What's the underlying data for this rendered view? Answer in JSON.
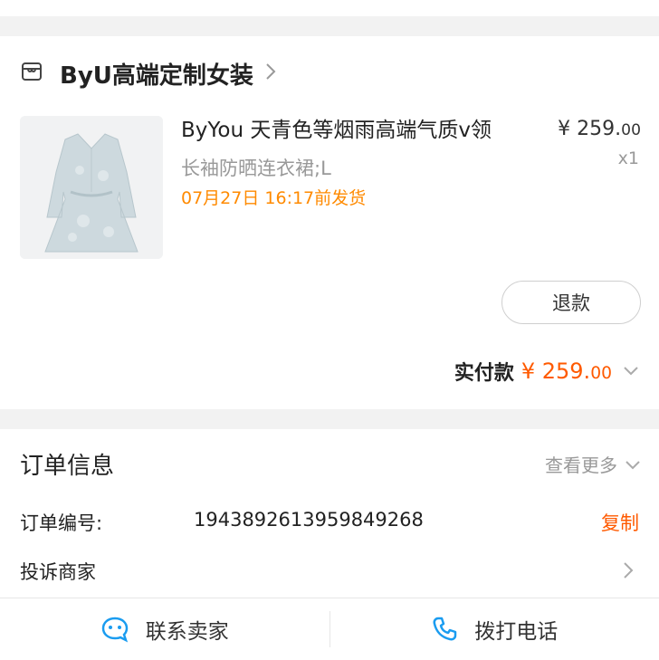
{
  "shop": {
    "name": "ByU高端定制女装",
    "icon": "store-icon"
  },
  "product": {
    "title": "ByYou 天青色等烟雨高端气质v领",
    "sku": "长袖防晒连衣裙;L",
    "ship_note": "07月27日 16:17前发货",
    "price_currency": "¥",
    "price_int": "259.",
    "price_dec": "00",
    "qty": "x1"
  },
  "actions": {
    "refund": "退款"
  },
  "payment": {
    "label": "实付款",
    "currency": "¥",
    "amount_int": "259.",
    "amount_dec": "00"
  },
  "order_info": {
    "title": "订单信息",
    "more": "查看更多",
    "order_no_label": "订单编号:",
    "order_no_value": "1943892613959849268",
    "copy": "复制",
    "complain": "投诉商家"
  },
  "bottom": {
    "contact": "联系卖家",
    "call": "拨打电话"
  },
  "colors": {
    "accent": "#ff5a00",
    "ship": "#ff8a00",
    "icon_blue": "#1a9cf0"
  }
}
